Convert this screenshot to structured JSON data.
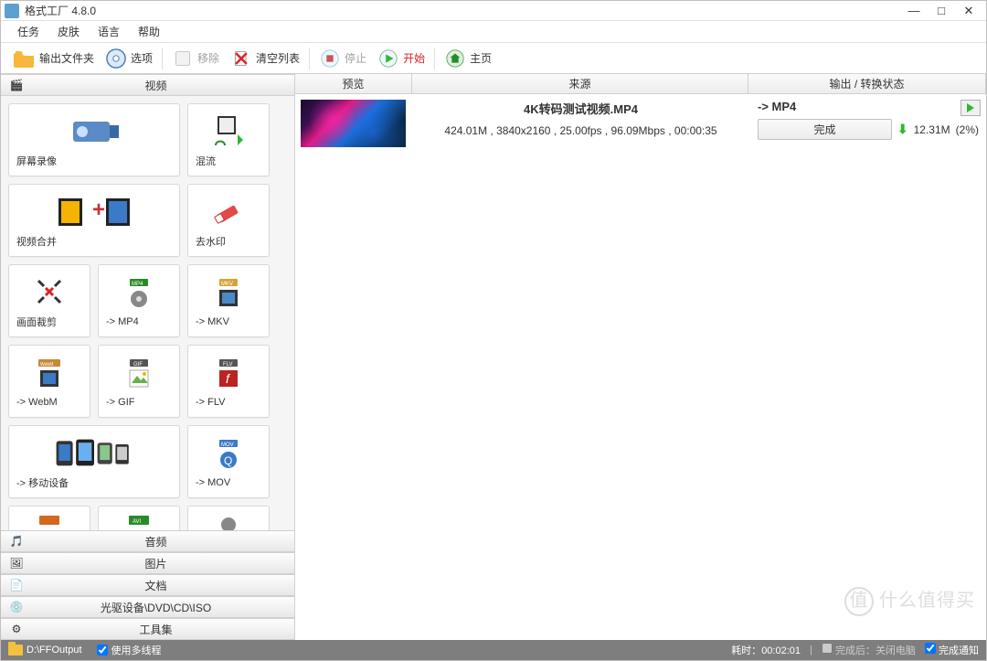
{
  "window": {
    "title": "格式工厂 4.8.0"
  },
  "menu": {
    "tasks": "任务",
    "skin": "皮肤",
    "language": "语言",
    "help": "帮助"
  },
  "toolbar": {
    "output_folder": "输出文件夹",
    "options": "选项",
    "remove": "移除",
    "clear_list": "清空列表",
    "stop": "停止",
    "start": "开始",
    "homepage": "主页"
  },
  "categories": {
    "video": "视频",
    "audio": "音频",
    "picture": "图片",
    "document": "文档",
    "optical": "光驱设备\\DVD\\CD\\ISO",
    "toolset": "工具集"
  },
  "tools": {
    "screen_record": "屏幕录像",
    "mux": "混流",
    "video_merge": "视频合并",
    "remove_watermark": "去水印",
    "crop": "画面裁剪",
    "to_mp4": "-> MP4",
    "to_mkv": "-> MKV",
    "to_webm": "-> WebM",
    "to_gif": "-> GIF",
    "to_flv": "-> FLV",
    "to_mobile": "-> 移动设备",
    "to_mov": "-> MOV"
  },
  "list_headers": {
    "preview": "预览",
    "source": "来源",
    "output": "输出 / 转换状态"
  },
  "task": {
    "filename": "4K转码测试视频.MP4",
    "info": "424.01M , 3840x2160 , 25.00fps , 96.09Mbps , 00:00:35",
    "target": "-> MP4",
    "status": "完成",
    "progress_size": "12.31M",
    "progress_pct": "(2%)"
  },
  "statusbar": {
    "output_path": "D:\\FFOutput",
    "multi_thread": "使用多线程",
    "elapsed_label": "耗时：",
    "elapsed": "00:02:01",
    "shutdown_label": "关闭电脑",
    "done_notify": "完成通知",
    "after_label": "完成后："
  },
  "watermark": "什么值得买"
}
